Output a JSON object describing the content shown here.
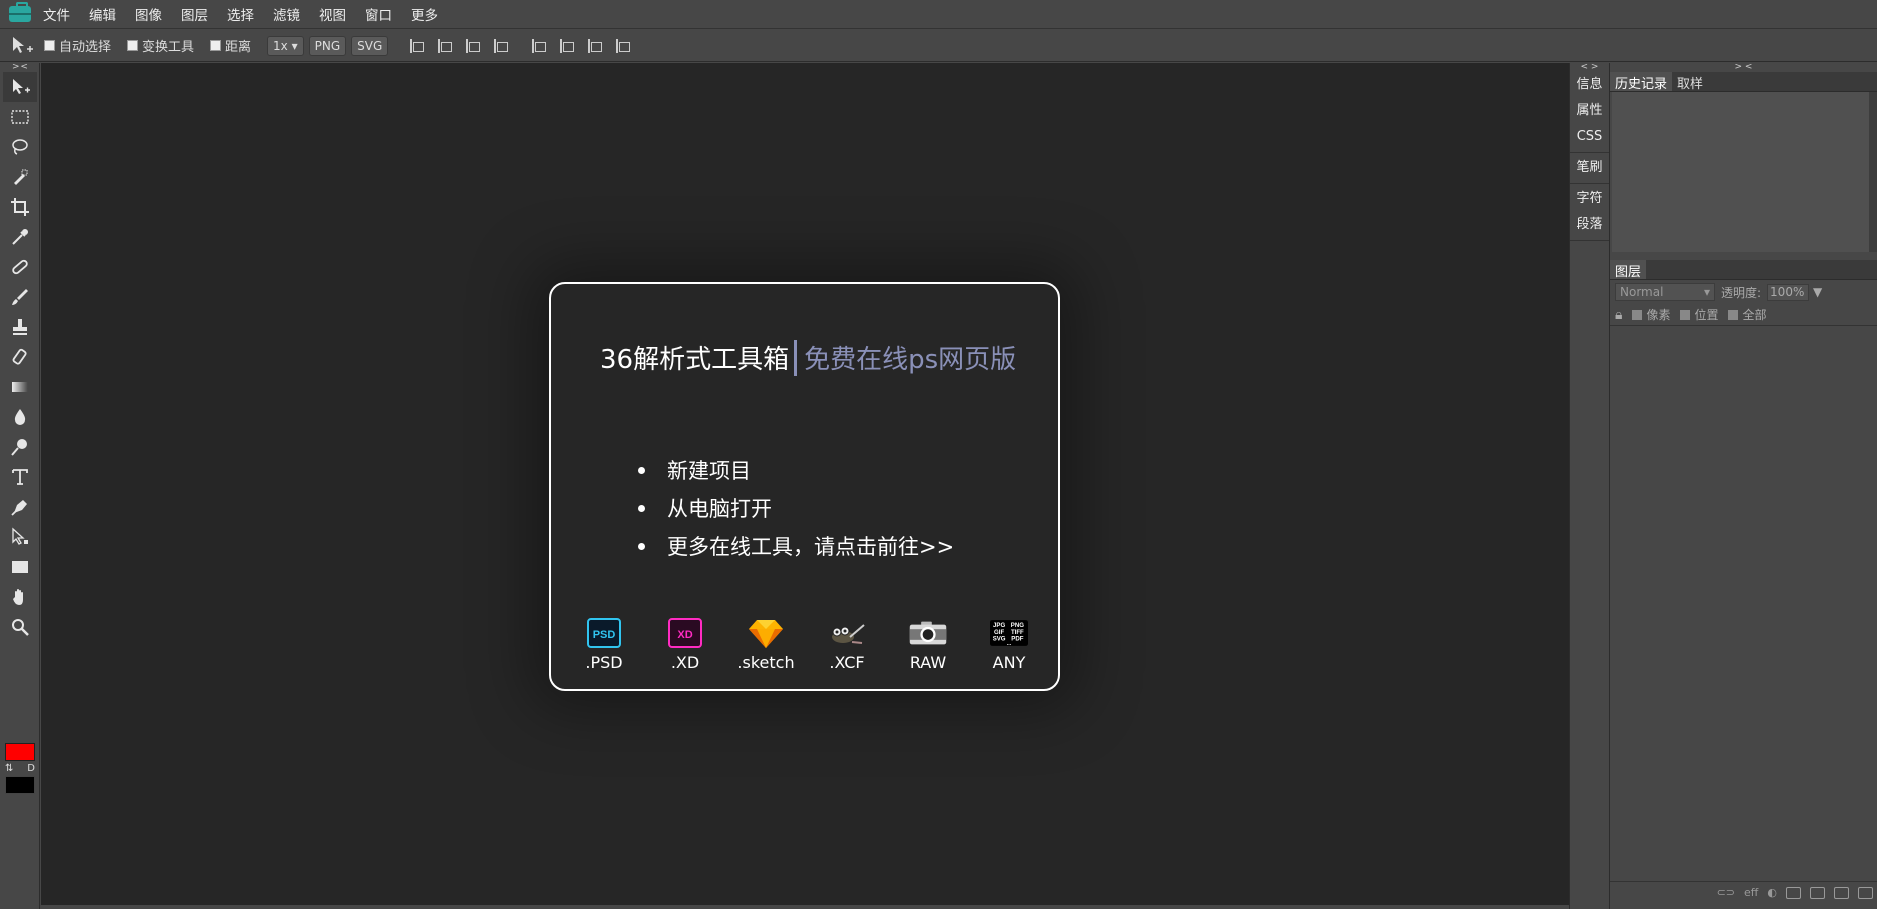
{
  "menu": [
    "文件",
    "编辑",
    "图像",
    "图层",
    "选择",
    "滤镜",
    "视图",
    "窗口",
    "更多"
  ],
  "options": {
    "auto_select": "自动选择",
    "transform_tool": "变换工具",
    "distance": "距离",
    "scale": "1x",
    "png": "PNG",
    "svg": "SVG"
  },
  "collapse": {
    "left": "> <",
    "strip": "< >",
    "panels": "> <"
  },
  "swatch": {
    "swap": "⇅",
    "default": "D",
    "foreground": "#ff0000",
    "background": "#000000"
  },
  "dialog": {
    "title": "36解析式工具箱",
    "subtitle": "免费在线ps网页版",
    "actions": [
      "新建项目",
      "从电脑打开",
      "更多在线工具，请点击前往>>"
    ],
    "formats": [
      ".PSD",
      ".XD",
      ".sketch",
      ".XCF",
      "RAW",
      "ANY"
    ],
    "format_icons": {
      "psd": "PSD",
      "xd": "XD"
    },
    "any_icon": [
      "JPG",
      "PNG",
      "GIF",
      "TIFF",
      "SVG",
      "PDF",
      "..."
    ]
  },
  "side_strip": [
    "信息",
    "属性",
    "CSS",
    "笔刷",
    "字符",
    "段落"
  ],
  "panels": {
    "history_tab": "历史记录",
    "swatch_tab": "取样",
    "layers_tab": "图层",
    "blend_mode": "Normal",
    "opacity_label": "透明度:",
    "opacity_value": "100%",
    "lock_pixels": "像素",
    "lock_position": "位置",
    "lock_all": "全部",
    "footer_eff": "eff"
  }
}
